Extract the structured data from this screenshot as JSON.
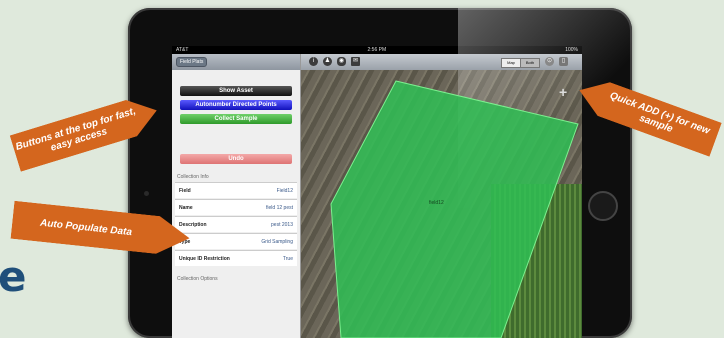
{
  "page_letter": "e",
  "status": {
    "carrier": "AT&T",
    "time": "2:56 PM",
    "battery": "100%"
  },
  "left_panel": {
    "back_label": "Field Plats",
    "buttons": [
      {
        "label": "Show Asset",
        "color": "#2b2b2b"
      },
      {
        "label": "Autonumber Directed Points",
        "color": "#2222cc"
      },
      {
        "label": "Collect Sample",
        "color": "#39a534"
      },
      {
        "label": "Undo",
        "color": "#e68a8a"
      }
    ],
    "collection_info_header": "Collection Info",
    "rows": [
      {
        "key": "Field",
        "value": "Field12"
      },
      {
        "key": "Name",
        "value": "field 12 pest"
      },
      {
        "key": "Description",
        "value": "pest 2013"
      },
      {
        "key": "Type",
        "value": "Grid Sampling"
      },
      {
        "key": "Unique ID Restriction",
        "value": "True"
      }
    ],
    "collection_options_header": "Collection Options"
  },
  "map": {
    "toolbar_icons": [
      "info-icon",
      "person-icon",
      "eye-icon",
      "mail-icon"
    ],
    "segments": [
      "Map",
      "Both"
    ],
    "field_label": "field12",
    "field_color": "#2fbf55",
    "add_label": "+"
  },
  "callouts": {
    "buttons_top": "Buttons at the top for fast, easy access",
    "auto_populate": "Auto Populate Data",
    "quick_add": "Quick ADD (+) for new sample"
  }
}
